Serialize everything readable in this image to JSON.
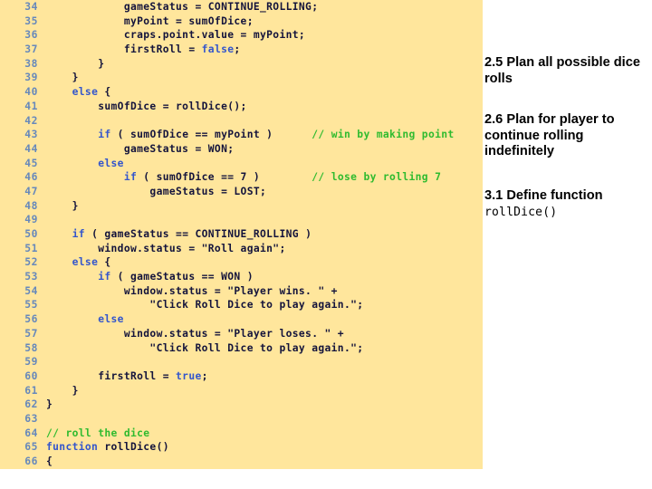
{
  "slide": {
    "background_color": "#ffffff"
  },
  "code_panel": {
    "background_color": "#ffe69c",
    "line_number_color": "#6688bb",
    "text_color": "#14143c",
    "keyword_color": "#3355cc",
    "comment_color": "#2fbb2f",
    "first_line_number": 34,
    "last_line_number": 66,
    "lines": [
      {
        "num": "34",
        "tokens": [
          {
            "t": "            gameStatus = CONTINUE_ROLLING;",
            "c": "pl"
          }
        ]
      },
      {
        "num": "35",
        "tokens": [
          {
            "t": "            myPoint = sumOfDice;",
            "c": "pl"
          }
        ]
      },
      {
        "num": "36",
        "tokens": [
          {
            "t": "            craps.point.value = myPoint;",
            "c": "pl"
          }
        ]
      },
      {
        "num": "37",
        "tokens": [
          {
            "t": "            firstRoll = ",
            "c": "pl"
          },
          {
            "t": "false",
            "c": "kw"
          },
          {
            "t": ";",
            "c": "pl"
          }
        ]
      },
      {
        "num": "38",
        "tokens": [
          {
            "t": "        }",
            "c": "pl"
          }
        ]
      },
      {
        "num": "39",
        "tokens": [
          {
            "t": "    }",
            "c": "pl"
          }
        ]
      },
      {
        "num": "40",
        "tokens": [
          {
            "t": "    ",
            "c": "pl"
          },
          {
            "t": "else",
            "c": "kw"
          },
          {
            "t": " {",
            "c": "pl"
          }
        ]
      },
      {
        "num": "41",
        "tokens": [
          {
            "t": "        sumOfDice = rollDice();",
            "c": "pl"
          }
        ]
      },
      {
        "num": "42",
        "tokens": []
      },
      {
        "num": "43",
        "tokens": [
          {
            "t": "        ",
            "c": "pl"
          },
          {
            "t": "if",
            "c": "kw"
          },
          {
            "t": " ( sumOfDice == myPoint )      ",
            "c": "pl"
          },
          {
            "t": "// win by making point",
            "c": "cmt"
          }
        ]
      },
      {
        "num": "44",
        "tokens": [
          {
            "t": "            gameStatus = WON;",
            "c": "pl"
          }
        ]
      },
      {
        "num": "45",
        "tokens": [
          {
            "t": "        ",
            "c": "pl"
          },
          {
            "t": "else",
            "c": "kw"
          }
        ]
      },
      {
        "num": "46",
        "tokens": [
          {
            "t": "            ",
            "c": "pl"
          },
          {
            "t": "if",
            "c": "kw"
          },
          {
            "t": " ( sumOfDice == 7 )        ",
            "c": "pl"
          },
          {
            "t": "// lose by rolling 7",
            "c": "cmt"
          }
        ]
      },
      {
        "num": "47",
        "tokens": [
          {
            "t": "                gameStatus = LOST;",
            "c": "pl"
          }
        ]
      },
      {
        "num": "48",
        "tokens": [
          {
            "t": "    }",
            "c": "pl"
          }
        ]
      },
      {
        "num": "49",
        "tokens": []
      },
      {
        "num": "50",
        "tokens": [
          {
            "t": "    ",
            "c": "pl"
          },
          {
            "t": "if",
            "c": "kw"
          },
          {
            "t": " ( gameStatus == CONTINUE_ROLLING )",
            "c": "pl"
          }
        ]
      },
      {
        "num": "51",
        "tokens": [
          {
            "t": "        window.status = \"Roll again\";",
            "c": "pl"
          }
        ]
      },
      {
        "num": "52",
        "tokens": [
          {
            "t": "    ",
            "c": "pl"
          },
          {
            "t": "else",
            "c": "kw"
          },
          {
            "t": " {",
            "c": "pl"
          }
        ]
      },
      {
        "num": "53",
        "tokens": [
          {
            "t": "        ",
            "c": "pl"
          },
          {
            "t": "if",
            "c": "kw"
          },
          {
            "t": " ( gameStatus == WON )",
            "c": "pl"
          }
        ]
      },
      {
        "num": "54",
        "tokens": [
          {
            "t": "            window.status = \"Player wins. \" +",
            "c": "pl"
          }
        ]
      },
      {
        "num": "55",
        "tokens": [
          {
            "t": "                \"Click Roll Dice to play again.\";",
            "c": "pl"
          }
        ]
      },
      {
        "num": "56",
        "tokens": [
          {
            "t": "        ",
            "c": "pl"
          },
          {
            "t": "else",
            "c": "kw"
          }
        ]
      },
      {
        "num": "57",
        "tokens": [
          {
            "t": "            window.status = \"Player loses. \" +",
            "c": "pl"
          }
        ]
      },
      {
        "num": "58",
        "tokens": [
          {
            "t": "                \"Click Roll Dice to play again.\";",
            "c": "pl"
          }
        ]
      },
      {
        "num": "59",
        "tokens": []
      },
      {
        "num": "60",
        "tokens": [
          {
            "t": "        firstRoll = ",
            "c": "pl"
          },
          {
            "t": "true",
            "c": "kw"
          },
          {
            "t": ";",
            "c": "pl"
          }
        ]
      },
      {
        "num": "61",
        "tokens": [
          {
            "t": "    }",
            "c": "pl"
          }
        ]
      },
      {
        "num": "62",
        "tokens": [
          {
            "t": "}",
            "c": "pl"
          }
        ]
      },
      {
        "num": "63",
        "tokens": []
      },
      {
        "num": "64",
        "tokens": [
          {
            "t": "",
            "c": "pl"
          },
          {
            "t": "// roll the dice",
            "c": "cmt"
          }
        ]
      },
      {
        "num": "65",
        "tokens": [
          {
            "t": "",
            "c": "pl"
          },
          {
            "t": "function",
            "c": "kw"
          },
          {
            "t": " rollDice()",
            "c": "pl"
          }
        ]
      },
      {
        "num": "66",
        "tokens": [
          {
            "t": "{",
            "c": "pl"
          }
        ]
      }
    ]
  },
  "notes_panel": {
    "background_color": "#ffffff",
    "text_color": "#000000",
    "notes": [
      {
        "text": "2.5 Plan all possible dice rolls",
        "mono": ""
      },
      {
        "text": "2.6 Plan for player to continue rolling indefinitely",
        "mono": ""
      },
      {
        "text": "3.1 Define function ",
        "mono": "rollDice()"
      }
    ]
  }
}
